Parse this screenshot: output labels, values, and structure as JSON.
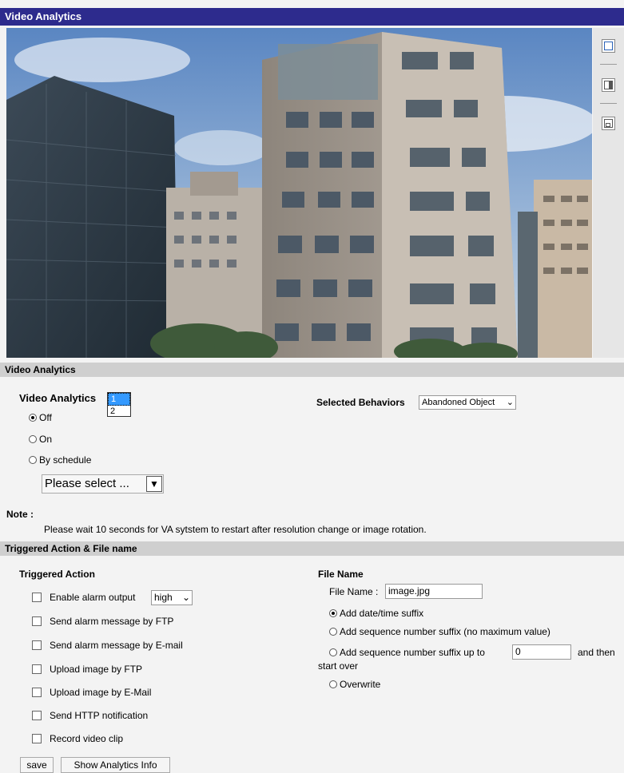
{
  "window": {
    "title": "Video Analytics"
  },
  "view_tools": [
    {
      "icon": "single-view-icon"
    },
    {
      "icon": "split-view-icon"
    },
    {
      "icon": "picture-in-picture-icon"
    }
  ],
  "va_section": {
    "header": "Video Analytics",
    "label": "Video Analytics",
    "list_options": [
      "1",
      "2"
    ],
    "list_selected": "1",
    "modes": [
      {
        "label": "Off",
        "checked": true
      },
      {
        "label": "On",
        "checked": false
      },
      {
        "label": "By schedule",
        "checked": false
      }
    ],
    "schedule_placeholder": "Please select ...",
    "behaviors_label": "Selected Behaviors",
    "behaviors_value": "Abandoned Object"
  },
  "note": {
    "label": "Note :",
    "text": "Please wait 10 seconds for VA sytstem to restart after resolution change or image rotation."
  },
  "action_section": {
    "header": "Triggered Action & File name",
    "triggered_title": "Triggered Action",
    "actions": [
      "Enable alarm output",
      "Send alarm message by FTP",
      "Send alarm message by E-mail",
      "Upload image by FTP",
      "Upload image by E-Mail",
      "Send HTTP notification",
      "Record video clip"
    ],
    "alarm_level": "high",
    "file_title": "File Name",
    "file_label": "File Name :",
    "file_value": "image.jpg",
    "file_options": [
      {
        "label": "Add date/time suffix",
        "checked": true
      },
      {
        "label": "Add sequence number suffix (no maximum value)",
        "checked": false
      },
      {
        "label": "Add sequence number suffix up to",
        "checked": false
      },
      {
        "label": "Overwrite",
        "checked": false
      }
    ],
    "seq_max": "0",
    "and_then": "and then",
    "start_over": "start over"
  },
  "buttons": {
    "save": "save",
    "show_info": "Show Analytics Info"
  }
}
